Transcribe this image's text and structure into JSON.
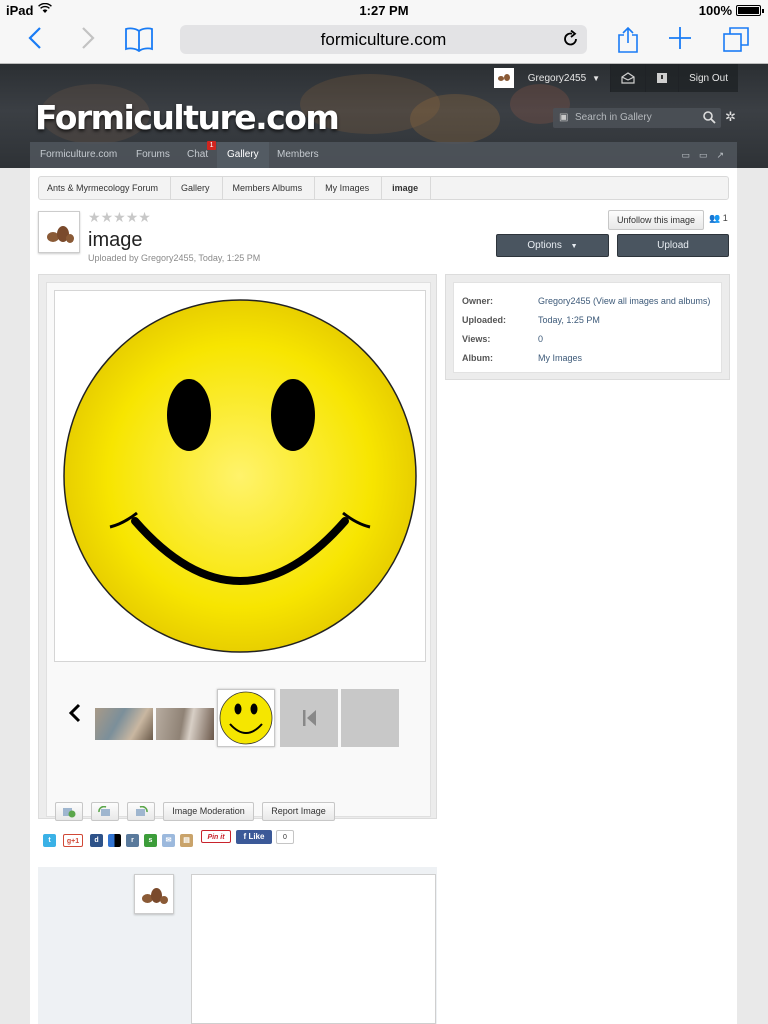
{
  "status_bar": {
    "device": "iPad",
    "time": "1:27 PM",
    "battery": "100%",
    "battery_level": 1.0
  },
  "browser": {
    "url": "formiculture.com"
  },
  "header": {
    "logo": "Formiculture.com",
    "username": "Gregory2455",
    "sign_out": "Sign Out",
    "search_placeholder": "Search in Gallery",
    "nav": [
      "Formiculture.com",
      "Forums",
      "Chat",
      "Gallery",
      "Members"
    ],
    "chat_badge": "1",
    "active_nav": "Gallery"
  },
  "breadcrumb": [
    "Ants & Myrmecology Forum",
    "Gallery",
    "Members Albums",
    "My Images",
    "image"
  ],
  "image_page": {
    "title": "image",
    "uploaded_by": "Uploaded by Gregory2455, Today, 1:25 PM",
    "rating": 0,
    "rating_max": 5,
    "follow_button": "Unfollow this image",
    "followers": "1",
    "options_button": "Options",
    "upload_button": "Upload",
    "image_moderation": "Image Moderation",
    "report_image": "Report Image"
  },
  "info": {
    "owner_label": "Owner:",
    "owner_value": "Gregory2455 (View all images and albums)",
    "uploaded_label": "Uploaded:",
    "uploaded_value": "Today, 1:25 PM",
    "views_label": "Views:",
    "views_value": "0",
    "album_label": "Album:",
    "album_value": "My Images"
  },
  "share": {
    "gplus": "g+1",
    "pinit": "Pin it",
    "fb_like": "Like",
    "fb_count": "0"
  },
  "colors": {
    "header_bg": "#2e3236",
    "nav_active": "#535b63",
    "link": "#3d5a79",
    "smiley_yellow": "#f5e600",
    "badge_red": "#d0251f"
  }
}
